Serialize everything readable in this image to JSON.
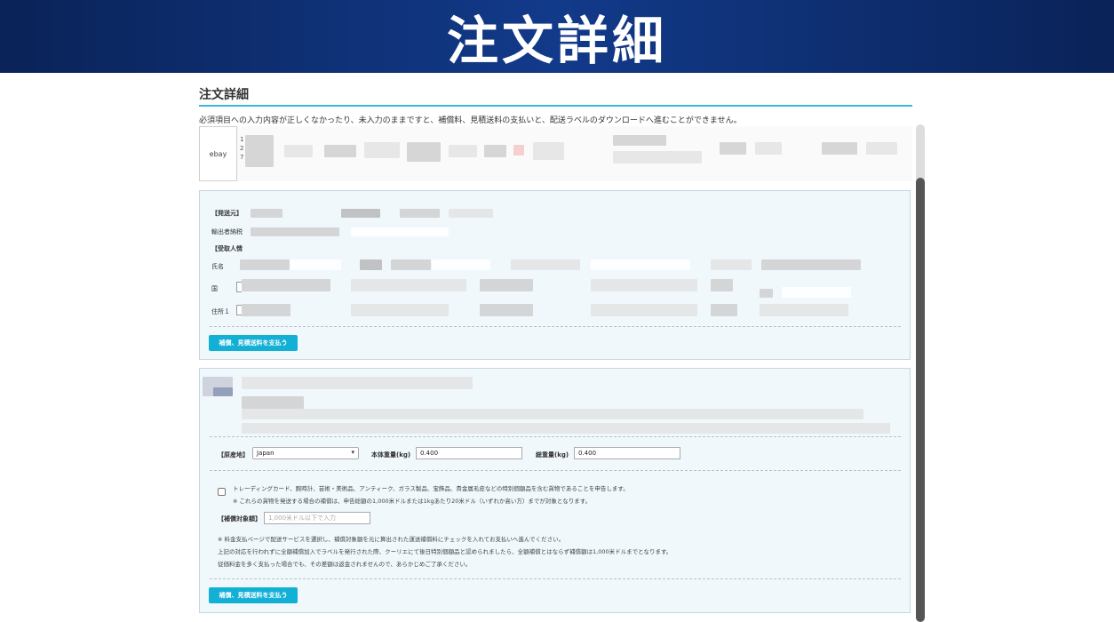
{
  "banner": {
    "title": "注文詳細"
  },
  "page": {
    "title": "注文詳細",
    "notice": "必須項目への入力内容が正しくなかったり、未入力のままですと、補償料、見積送料の支払いと、配送ラベルのダウンロードへ進むことができません。"
  },
  "order": {
    "marketplace": "ebay",
    "digits": [
      "1",
      "2",
      "7"
    ]
  },
  "shipping_panel": {
    "sender_label": "【発送元】",
    "exporter_label": "輸出者納税",
    "recipient_label": "【受取人情",
    "name_label": "氏名",
    "country_label": "国",
    "address_label": "住所１",
    "pay_button": "補償、見積送料を支払う"
  },
  "item_panel": {
    "origin_label": "【原産地】",
    "origin_value": "Japan",
    "net_weight_label": "本体重量(kg)",
    "net_weight_value": "0.400",
    "gross_weight_label": "総重量(kg)",
    "gross_weight_value": "0.400",
    "declaration_text": "トレーディングカード、腕時計、芸術・美術品、アンティーク、ガラス製品、宝飾品、貴金属毛皮などの特別個額品を含む貨物であることを申告します。",
    "declaration_note": "※ これらの貨物を発送する場合の補償は、申告総額の1,000米ドルまたは1kgあたり20米ドル（いずれか高い方）までが対象となります。",
    "insured_amount_label": "【補償対象額】",
    "insured_amount_placeholder": "1,000米ドル以下で入力",
    "note1": "※ 料金支払ページで配送サービスを選択し、補償対象額を元に算出された運送補償料にチェックを入れてお支払いへ進んでください。",
    "note2": "上記の対応を行われずに全額補償加入でラベルを発行された際、クーリエにて後日特別個額品と認められましたら、全額補償とはならず補償額は1,000米ドルまでとなります。",
    "note3": "従価料金を多く支払った場合でも、その差額は返金されませんので、あらかじめご了承ください。",
    "pay_button": "補償、見積送料を支払う"
  },
  "colors": {
    "banner": "#0a2358",
    "accent": "#13b0d6",
    "rule": "#3cb4dc",
    "panel_bg": "#f0f8fc"
  }
}
